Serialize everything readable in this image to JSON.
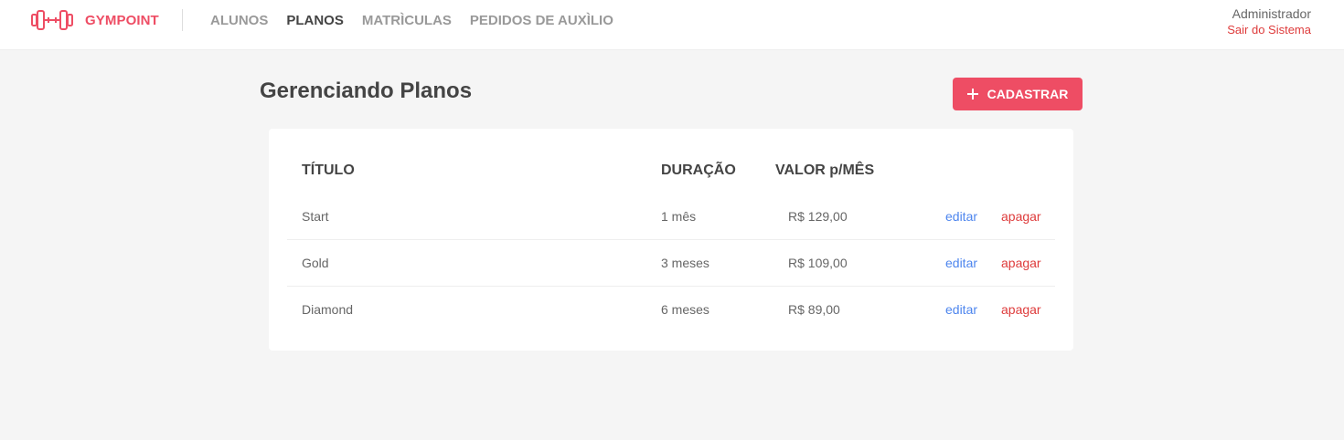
{
  "brand": {
    "name": "GYMPOINT",
    "color": "#ee4d64",
    "icon": "dumbbell-icon"
  },
  "nav": [
    {
      "label": "ALUNOS",
      "active": false
    },
    {
      "label": "PLANOS",
      "active": true
    },
    {
      "label": "MATRÌCULAS",
      "active": false
    },
    {
      "label": "PEDIDOS DE AUXÌLIO",
      "active": false
    }
  ],
  "user": {
    "name": "Administrador",
    "logout_label": "Sair do Sistema"
  },
  "page": {
    "title": "Gerenciando Planos",
    "add_label": "CADASTRAR",
    "add_icon": "plus-icon"
  },
  "table": {
    "headers": {
      "title": "TÍTULO",
      "duration": "DURAÇÃO",
      "price": "VALOR p/MÊS"
    },
    "rows": [
      {
        "title": "Start",
        "duration": "1 mês",
        "price": "R$ 129,00",
        "edit": "editar",
        "delete": "apagar"
      },
      {
        "title": "Gold",
        "duration": "3 meses",
        "price": "R$ 109,00",
        "edit": "editar",
        "delete": "apagar"
      },
      {
        "title": "Diamond",
        "duration": "6 meses",
        "price": "R$ 89,00",
        "edit": "editar",
        "delete": "apagar"
      }
    ]
  },
  "colors": {
    "accent": "#ee4d64",
    "edit_link": "#4d85ee",
    "delete_link": "#de3b3b",
    "background": "#f5f5f5"
  }
}
